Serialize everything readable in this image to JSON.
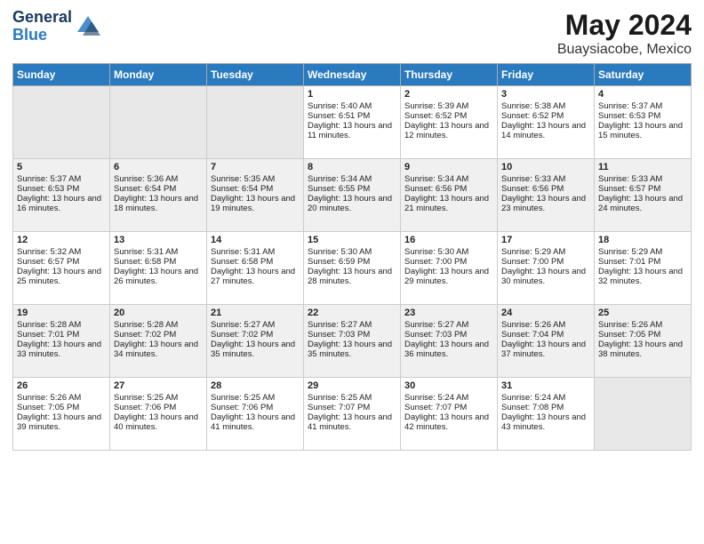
{
  "header": {
    "logo_general": "General",
    "logo_blue": "Blue",
    "month": "May 2024",
    "location": "Buaysiacobe, Mexico"
  },
  "days_of_week": [
    "Sunday",
    "Monday",
    "Tuesday",
    "Wednesday",
    "Thursday",
    "Friday",
    "Saturday"
  ],
  "weeks": [
    [
      {
        "num": "",
        "empty": true
      },
      {
        "num": "",
        "empty": true
      },
      {
        "num": "",
        "empty": true
      },
      {
        "num": "1",
        "sunrise": "Sunrise: 5:40 AM",
        "sunset": "Sunset: 6:51 PM",
        "daylight": "Daylight: 13 hours and 11 minutes."
      },
      {
        "num": "2",
        "sunrise": "Sunrise: 5:39 AM",
        "sunset": "Sunset: 6:52 PM",
        "daylight": "Daylight: 13 hours and 12 minutes."
      },
      {
        "num": "3",
        "sunrise": "Sunrise: 5:38 AM",
        "sunset": "Sunset: 6:52 PM",
        "daylight": "Daylight: 13 hours and 14 minutes."
      },
      {
        "num": "4",
        "sunrise": "Sunrise: 5:37 AM",
        "sunset": "Sunset: 6:53 PM",
        "daylight": "Daylight: 13 hours and 15 minutes."
      }
    ],
    [
      {
        "num": "5",
        "sunrise": "Sunrise: 5:37 AM",
        "sunset": "Sunset: 6:53 PM",
        "daylight": "Daylight: 13 hours and 16 minutes."
      },
      {
        "num": "6",
        "sunrise": "Sunrise: 5:36 AM",
        "sunset": "Sunset: 6:54 PM",
        "daylight": "Daylight: 13 hours and 18 minutes."
      },
      {
        "num": "7",
        "sunrise": "Sunrise: 5:35 AM",
        "sunset": "Sunset: 6:54 PM",
        "daylight": "Daylight: 13 hours and 19 minutes."
      },
      {
        "num": "8",
        "sunrise": "Sunrise: 5:34 AM",
        "sunset": "Sunset: 6:55 PM",
        "daylight": "Daylight: 13 hours and 20 minutes."
      },
      {
        "num": "9",
        "sunrise": "Sunrise: 5:34 AM",
        "sunset": "Sunset: 6:56 PM",
        "daylight": "Daylight: 13 hours and 21 minutes."
      },
      {
        "num": "10",
        "sunrise": "Sunrise: 5:33 AM",
        "sunset": "Sunset: 6:56 PM",
        "daylight": "Daylight: 13 hours and 23 minutes."
      },
      {
        "num": "11",
        "sunrise": "Sunrise: 5:33 AM",
        "sunset": "Sunset: 6:57 PM",
        "daylight": "Daylight: 13 hours and 24 minutes."
      }
    ],
    [
      {
        "num": "12",
        "sunrise": "Sunrise: 5:32 AM",
        "sunset": "Sunset: 6:57 PM",
        "daylight": "Daylight: 13 hours and 25 minutes."
      },
      {
        "num": "13",
        "sunrise": "Sunrise: 5:31 AM",
        "sunset": "Sunset: 6:58 PM",
        "daylight": "Daylight: 13 hours and 26 minutes."
      },
      {
        "num": "14",
        "sunrise": "Sunrise: 5:31 AM",
        "sunset": "Sunset: 6:58 PM",
        "daylight": "Daylight: 13 hours and 27 minutes."
      },
      {
        "num": "15",
        "sunrise": "Sunrise: 5:30 AM",
        "sunset": "Sunset: 6:59 PM",
        "daylight": "Daylight: 13 hours and 28 minutes."
      },
      {
        "num": "16",
        "sunrise": "Sunrise: 5:30 AM",
        "sunset": "Sunset: 7:00 PM",
        "daylight": "Daylight: 13 hours and 29 minutes."
      },
      {
        "num": "17",
        "sunrise": "Sunrise: 5:29 AM",
        "sunset": "Sunset: 7:00 PM",
        "daylight": "Daylight: 13 hours and 30 minutes."
      },
      {
        "num": "18",
        "sunrise": "Sunrise: 5:29 AM",
        "sunset": "Sunset: 7:01 PM",
        "daylight": "Daylight: 13 hours and 32 minutes."
      }
    ],
    [
      {
        "num": "19",
        "sunrise": "Sunrise: 5:28 AM",
        "sunset": "Sunset: 7:01 PM",
        "daylight": "Daylight: 13 hours and 33 minutes."
      },
      {
        "num": "20",
        "sunrise": "Sunrise: 5:28 AM",
        "sunset": "Sunset: 7:02 PM",
        "daylight": "Daylight: 13 hours and 34 minutes."
      },
      {
        "num": "21",
        "sunrise": "Sunrise: 5:27 AM",
        "sunset": "Sunset: 7:02 PM",
        "daylight": "Daylight: 13 hours and 35 minutes."
      },
      {
        "num": "22",
        "sunrise": "Sunrise: 5:27 AM",
        "sunset": "Sunset: 7:03 PM",
        "daylight": "Daylight: 13 hours and 35 minutes."
      },
      {
        "num": "23",
        "sunrise": "Sunrise: 5:27 AM",
        "sunset": "Sunset: 7:03 PM",
        "daylight": "Daylight: 13 hours and 36 minutes."
      },
      {
        "num": "24",
        "sunrise": "Sunrise: 5:26 AM",
        "sunset": "Sunset: 7:04 PM",
        "daylight": "Daylight: 13 hours and 37 minutes."
      },
      {
        "num": "25",
        "sunrise": "Sunrise: 5:26 AM",
        "sunset": "Sunset: 7:05 PM",
        "daylight": "Daylight: 13 hours and 38 minutes."
      }
    ],
    [
      {
        "num": "26",
        "sunrise": "Sunrise: 5:26 AM",
        "sunset": "Sunset: 7:05 PM",
        "daylight": "Daylight: 13 hours and 39 minutes."
      },
      {
        "num": "27",
        "sunrise": "Sunrise: 5:25 AM",
        "sunset": "Sunset: 7:06 PM",
        "daylight": "Daylight: 13 hours and 40 minutes."
      },
      {
        "num": "28",
        "sunrise": "Sunrise: 5:25 AM",
        "sunset": "Sunset: 7:06 PM",
        "daylight": "Daylight: 13 hours and 41 minutes."
      },
      {
        "num": "29",
        "sunrise": "Sunrise: 5:25 AM",
        "sunset": "Sunset: 7:07 PM",
        "daylight": "Daylight: 13 hours and 41 minutes."
      },
      {
        "num": "30",
        "sunrise": "Sunrise: 5:24 AM",
        "sunset": "Sunset: 7:07 PM",
        "daylight": "Daylight: 13 hours and 42 minutes."
      },
      {
        "num": "31",
        "sunrise": "Sunrise: 5:24 AM",
        "sunset": "Sunset: 7:08 PM",
        "daylight": "Daylight: 13 hours and 43 minutes."
      },
      {
        "num": "",
        "empty": true
      }
    ]
  ]
}
